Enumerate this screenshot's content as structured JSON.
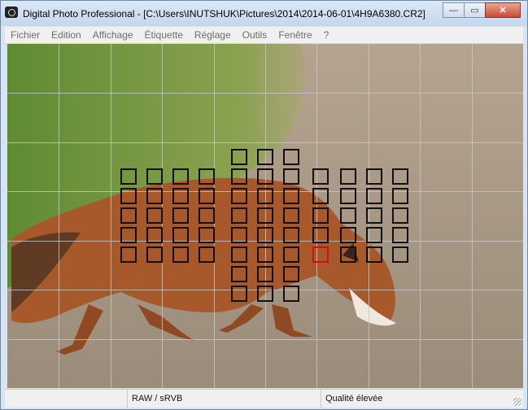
{
  "window": {
    "title": "Digital Photo Professional - [C:\\Users\\INUTSHUK\\Pictures\\2014\\2014-06-01\\4H9A6380.CR2]",
    "buttons": {
      "minimize": "—",
      "restore": "▭",
      "close": "✕"
    }
  },
  "menu": [
    "Fichier",
    "Edition",
    "Affichage",
    "Étiquette",
    "Réglage",
    "Outils",
    "Fenêtre",
    "?"
  ],
  "status": {
    "color_info": "RAW / sRVB",
    "quality": "Qualité élevée"
  },
  "colors": {
    "af_point": "#111111",
    "af_point_active": "#d01010",
    "grid": "#c8c8c8"
  }
}
